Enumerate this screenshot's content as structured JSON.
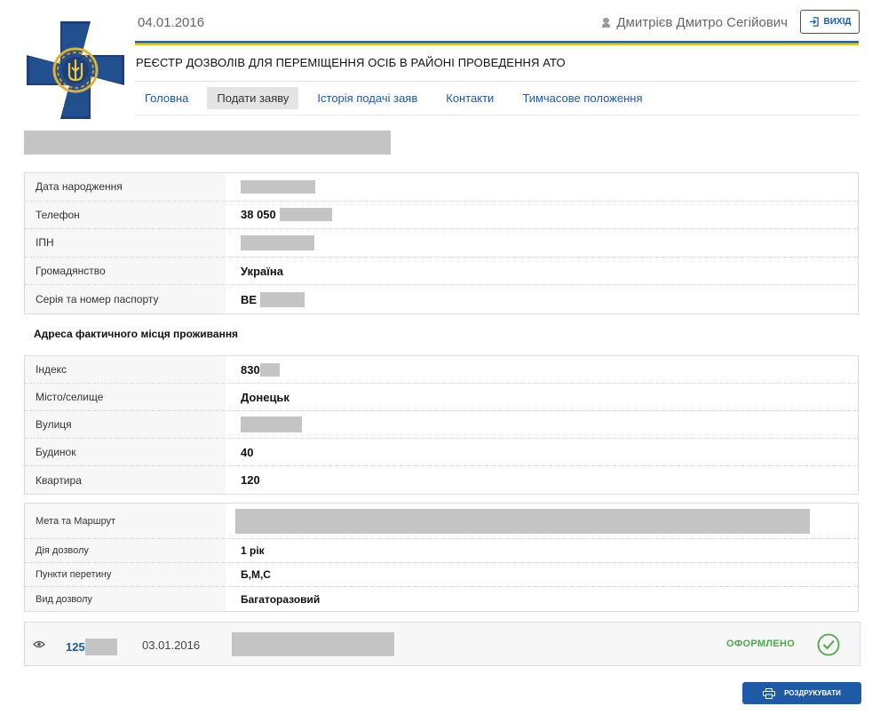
{
  "header": {
    "date": "04.01.2016",
    "user_name": "Дмитрієв Дмитро Сегійович",
    "exit_label": "ВИХІД",
    "registry_title": "РЕЄСТР ДОЗВОЛІВ ДЛЯ ПЕРЕМІЩЕННЯ ОСІБ В РАЙОНІ ПРОВЕДЕННЯ АТО",
    "logo_icon": "emblem-cross-trident-icon",
    "user_icon": "person-icon",
    "exit_icon": "logout-icon"
  },
  "nav": {
    "items": [
      {
        "label": "Головна",
        "active": false
      },
      {
        "label": "Подати заяву",
        "active": true
      },
      {
        "label": "Історія подачі заяв",
        "active": false
      },
      {
        "label": "Контакти",
        "active": false
      },
      {
        "label": "Тимчасове положення",
        "active": false
      }
    ]
  },
  "personal": {
    "birth_date_label": "Дата народження",
    "phone_label": "Телефон",
    "phone_prefix": "38 050",
    "tin_label": "ІПН",
    "citizenship_label": "Громадянство",
    "citizenship_value": "Україна",
    "passport_label": "Серія та номер паспорту",
    "passport_series": "ВЕ"
  },
  "address": {
    "heading": "Адреса фактичного місця проживання",
    "index_label": "Індекс",
    "index_value": "830",
    "city_label": "Місто/селище",
    "city_value": "Донецьк",
    "street_label": "Вулиця",
    "building_label": "Будинок",
    "building_value": "40",
    "apartment_label": "Квартира",
    "apartment_value": "120"
  },
  "permit": {
    "route_label": "Мета та Маршрут",
    "validity_label": "Дія дозволу",
    "validity_value": "1 рік",
    "crossings_label": "Пункти перетину",
    "crossings_value": "Б,М,С",
    "type_label": "Вид дозволу",
    "type_value": "Багаторазовий"
  },
  "application": {
    "number_prefix": "125",
    "date": "03.01.2016",
    "status": "ОФОРМЛЕНО",
    "status_color": "#4ba84b",
    "view_icon": "eye-icon",
    "status_icon": "check-circle-icon"
  },
  "actions": {
    "print_label": "РОЗДРУКУВАТИ",
    "print_icon": "printer-icon"
  },
  "colors": {
    "accent": "#1b5aa8",
    "flag_blue": "#1e63b8",
    "flag_yellow": "#f5c400",
    "redaction": "#c4c4c4"
  }
}
